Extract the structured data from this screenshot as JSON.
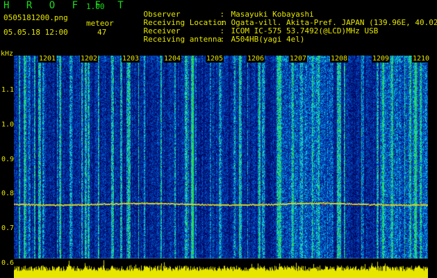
{
  "header": {
    "app_name": "H R O F F T",
    "app_version": "1.00",
    "filename": "0505181200.png",
    "datetime": "05.05.18 12:00",
    "meteor_label": "meteor",
    "meteor_count": "47"
  },
  "info": [
    {
      "label": "Observer",
      "value": "Masayuki Kobayashi"
    },
    {
      "label": "Receiving Location",
      "value": "Ogata-vill. Akita-Pref. JAPAN (139.96E, 40.02N)"
    },
    {
      "label": "Receiver",
      "value": "ICOM IC-575 53.7492(@LCD)MHz USB"
    },
    {
      "label": "Receiving antenna",
      "value": "A504HB(yagi 4el)"
    }
  ],
  "axis": {
    "y_unit": "kHz",
    "y_ticks": [
      "1.1",
      "1.0",
      "0.9",
      "0.8",
      "0.7",
      "0.6"
    ],
    "x_ticks": [
      "1201",
      "1202",
      "1203",
      "1204",
      "1205",
      "1206",
      "1207",
      "1208",
      "1209",
      "1210"
    ]
  },
  "chart_data": {
    "type": "heatmap",
    "title": "",
    "xlabel": "",
    "ylabel": "kHz",
    "x_categories": [
      "1201",
      "1202",
      "1203",
      "1204",
      "1205",
      "1206",
      "1207",
      "1208",
      "1209",
      "1210"
    ],
    "ylim": [
      0.6,
      1.15
    ],
    "carrier_frequency_khz": 0.77,
    "colors": {
      "background": "#000000",
      "noise_low": "#0a1a8c",
      "noise_mid": "#1e50d8",
      "noise_high": "#30e0c0",
      "signal": "#e0e020",
      "histogram": "#e6e600",
      "axis_text": "#e6e600",
      "title_text": "#18e018"
    }
  }
}
